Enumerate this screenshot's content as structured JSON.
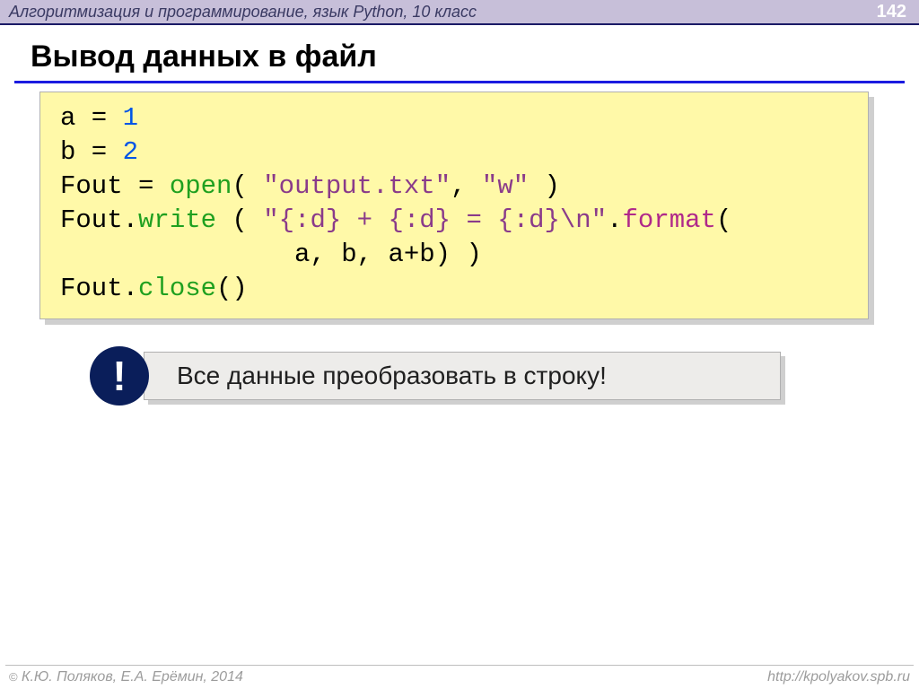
{
  "header": {
    "course": "Алгоритмизация и программирование, язык Python, 10 класс",
    "page": "142"
  },
  "title": "Вывод данных в файл",
  "code": {
    "l1_a": "a = ",
    "l1_b": "1",
    "l2_a": "b = ",
    "l2_b": "2",
    "l3_a": "Fout = ",
    "l3_b": "open",
    "l3_c": "( ",
    "l3_d": "\"output.txt\"",
    "l3_e": ", ",
    "l3_f": "\"w\"",
    "l3_g": " )",
    "l4_a": "Fout.",
    "l4_b": "write",
    "l4_c": " ( ",
    "l4_d": "\"{:d} + {:d} = {:d}\\n\"",
    "l4_e": ".",
    "l4_f": "format",
    "l4_g": "(",
    "l5_a": "               a, b, a+b) )",
    "l6_a": "Fout.",
    "l6_b": "close",
    "l6_c": "()"
  },
  "note": {
    "badge": "!",
    "text": "Все данные преобразовать в строку!"
  },
  "footer": {
    "copymark": "©",
    "left": " К.Ю. Поляков, Е.А. Ерёмин, 2014",
    "right": "http://kpolyakov.spb.ru"
  }
}
